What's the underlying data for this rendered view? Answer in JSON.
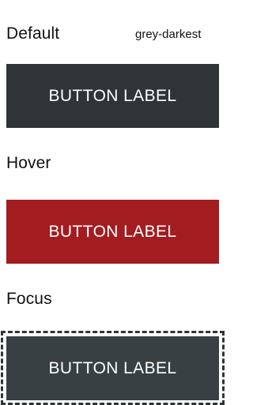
{
  "states": {
    "default": {
      "label": "Default",
      "token": "grey-darkest",
      "button_label": "BUTTON LABEL",
      "color": "#2f3437"
    },
    "hover": {
      "label": "Hover",
      "button_label": "BUTTON LABEL",
      "color": "#a31c1f"
    },
    "focus": {
      "label": "Focus",
      "button_label": "BUTTON LABEL",
      "color": "#384043",
      "ring_color": "#2f3437"
    }
  }
}
